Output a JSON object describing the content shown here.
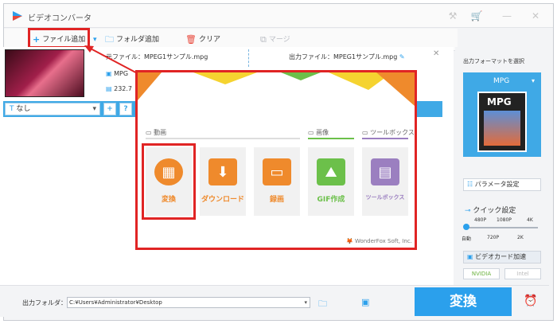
{
  "window": {
    "title": "ビデオコンバータ"
  },
  "toolbar": {
    "add_file": "ファイル追加",
    "add_folder": "フォルダ追加",
    "clear": "クリア",
    "merge": "マージ"
  },
  "file": {
    "source_label": "元ファイル：",
    "source_name": "MPEG1サンプル.mpg",
    "output_label": "出力ファイル：",
    "output_name": "MPEG1サンプル.mpg",
    "format": "MPG",
    "size": "232.7",
    "subtitle": "なし"
  },
  "popup": {
    "section_video": "動画",
    "section_image": "画像",
    "section_tools": "ツールボックス",
    "tiles": [
      {
        "label": "変換",
        "color": "#ef8a2c"
      },
      {
        "label": "ダウンロード",
        "color": "#ef8a2c"
      },
      {
        "label": "録画",
        "color": "#ef8a2c"
      },
      {
        "label": "GIF作成",
        "color": "#6cc04a"
      },
      {
        "label": "ツールボックス",
        "color": "#9b7fc0"
      }
    ],
    "brand": "WonderFox Soft, Inc."
  },
  "right": {
    "select_format_label": "出力フォーマットを選択",
    "format": "MPG",
    "format_icon_text": "MPG",
    "param_settings": "パラメータ設定",
    "quick_settings": "クイック設定",
    "scale_top": [
      "480P",
      "1080P",
      "4K"
    ],
    "scale_bottom": [
      "自動",
      "720P",
      "2K"
    ],
    "gpu_accel": "ビデオカード加速",
    "nvidia": "NVIDIA",
    "intel": "Intel"
  },
  "bottom": {
    "output_folder_label": "出力フォルダ：",
    "output_folder_value": "C:¥Users¥Administrator¥Desktop",
    "convert_button": "変換"
  },
  "colors": {
    "accent": "#2ba0ec",
    "highlight": "#e02424"
  }
}
